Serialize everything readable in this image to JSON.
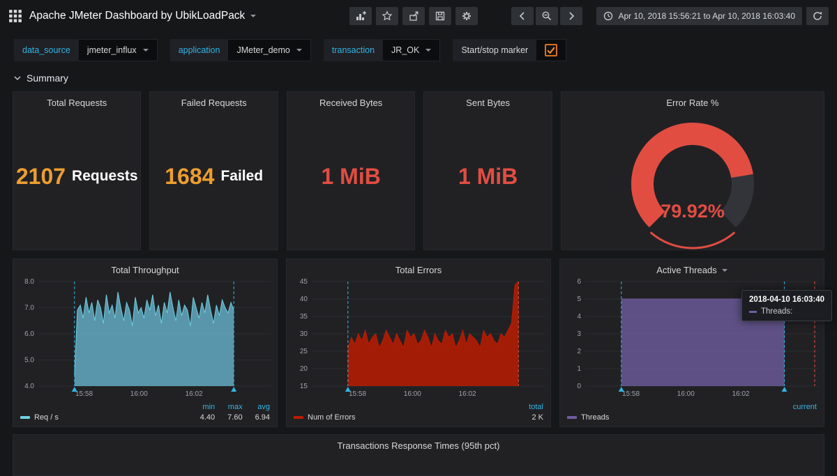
{
  "navbar": {
    "title": "Apache JMeter Dashboard by UbikLoadPack",
    "time_range": "Apr 10, 2018 15:56:21 to Apr 10, 2018 16:03:40"
  },
  "filters": [
    {
      "label": "data_source",
      "value": "jmeter_influx"
    },
    {
      "label": "application",
      "value": "JMeter_demo"
    },
    {
      "label": "transaction",
      "value": "JR_OK"
    }
  ],
  "marker_toggle": {
    "label": "Start/stop marker",
    "checked": true
  },
  "section": {
    "title": "Summary"
  },
  "stats": [
    {
      "title": "Total Requests",
      "value": "2107",
      "suffix": "Requests",
      "color": "#ed9e2f"
    },
    {
      "title": "Failed Requests",
      "value": "1684",
      "suffix": "Failed",
      "color": "#ed9e2f"
    },
    {
      "title": "Received Bytes",
      "value": "1 MiB",
      "suffix": "",
      "color": "#e24d42"
    },
    {
      "title": "Sent Bytes",
      "value": "1 MiB",
      "suffix": "",
      "color": "#e24d42"
    }
  ],
  "chart_gauge": {
    "type": "gauge",
    "title": "Error Rate %",
    "percent": 79.92,
    "label": "79.92%",
    "color": "#e24d42",
    "track_color": "#32343a",
    "range": [
      0,
      100
    ]
  },
  "chart_data": [
    {
      "id": "total-throughput",
      "type": "area",
      "title": "Total Throughput",
      "color": "#6ed0e0",
      "fill": "rgba(111,195,223,0.72)",
      "ymin": 4,
      "ymax": 8,
      "yticks": [
        "4.0",
        "5.0",
        "6.0",
        "7.0",
        "8.0"
      ],
      "xticks": [
        {
          "label": "15:58",
          "pos": 0.196
        },
        {
          "label": "16:00",
          "pos": 0.432
        },
        {
          "label": "16:02",
          "pos": 0.668
        }
      ],
      "data_start": 0.155,
      "data_end": 0.839,
      "values": [
        4.4,
        6.9,
        7.1,
        6.6,
        7.4,
        6.8,
        7.2,
        6.5,
        7.3,
        7.0,
        6.4,
        7.5,
        6.8,
        7.1,
        6.6,
        7.6,
        7.0,
        6.5,
        7.2,
        6.9,
        6.3,
        7.4,
        6.8,
        7.0,
        6.6,
        7.3,
        6.9,
        7.5,
        6.7,
        7.1,
        6.4,
        7.2,
        6.8,
        7.6,
        7.0,
        6.5,
        7.3,
        6.7,
        7.1,
        6.9,
        6.3,
        7.4,
        7.0,
        6.6,
        7.2,
        6.8,
        7.5,
        6.9,
        6.4,
        7.1,
        6.7,
        7.3,
        7.0,
        6.8,
        7.2,
        6.9
      ],
      "annotations": [
        {
          "pos": 0.155,
          "color": "#33b5e5",
          "marker": true
        },
        {
          "pos": 0.839,
          "color": "#33b5e5",
          "marker": true
        }
      ],
      "legend": {
        "series": "Req / s",
        "stats": [
          {
            "label": "min",
            "value": "4.40"
          },
          {
            "label": "max",
            "value": "7.60"
          },
          {
            "label": "avg",
            "value": "6.94"
          }
        ]
      }
    },
    {
      "id": "total-errors",
      "type": "area",
      "title": "Total Errors",
      "color": "#bf1b00",
      "fill": "rgba(191,27,0,0.82)",
      "ymin": 15,
      "ymax": 45,
      "yticks": [
        "15",
        "20",
        "25",
        "30",
        "35",
        "40",
        "45"
      ],
      "xticks": [
        {
          "label": "15:58",
          "pos": 0.196
        },
        {
          "label": "16:00",
          "pos": 0.432
        },
        {
          "label": "16:02",
          "pos": 0.668
        }
      ],
      "data_start": 0.155,
      "data_end": 0.887,
      "values": [
        26,
        29,
        27,
        30,
        28,
        31,
        27,
        29,
        30,
        26,
        28,
        31,
        29,
        27,
        30,
        28,
        26,
        31,
        29,
        30,
        27,
        28,
        31,
        29,
        26,
        30,
        28,
        27,
        31,
        29,
        30,
        26,
        28,
        31,
        27,
        30,
        29,
        28,
        26,
        31,
        29,
        30,
        28,
        27,
        30,
        29,
        31,
        33,
        44,
        45
      ],
      "annotations": [
        {
          "pos": 0.155,
          "color": "#33b5e5",
          "marker": true
        },
        {
          "pos": 0.887,
          "color": "#e24d42",
          "marker": false
        }
      ],
      "legend": {
        "series": "Num of Errors",
        "stats": [
          {
            "label": "total",
            "value": "2 K"
          }
        ]
      }
    },
    {
      "id": "active-threads",
      "type": "area",
      "title": "Active Threads",
      "title_caret": true,
      "color": "#705da0",
      "fill": "rgba(112,93,160,0.78)",
      "ymin": 0,
      "ymax": 6,
      "yticks": [
        "0",
        "1",
        "2",
        "3",
        "4",
        "5",
        "6"
      ],
      "xticks": [
        {
          "label": "15:58",
          "pos": 0.196
        },
        {
          "label": "16:00",
          "pos": 0.432
        },
        {
          "label": "16:02",
          "pos": 0.668
        }
      ],
      "data_start": 0.155,
      "data_end": 0.855,
      "values": [
        5,
        5,
        5,
        5,
        5,
        5
      ],
      "annotations": [
        {
          "pos": 0.155,
          "color": "#33b5e5",
          "marker": true
        },
        {
          "pos": 0.855,
          "color": "#33b5e5",
          "marker": true
        },
        {
          "pos": 0.985,
          "color": "#e24d42",
          "marker": false
        }
      ],
      "legend": {
        "series": "Threads",
        "stats": [
          {
            "label": "current",
            "value": ""
          }
        ]
      },
      "tooltip": {
        "time": "2018-04-10 16:03:40",
        "series_label": "Threads:",
        "swatch": "#705da0"
      }
    }
  ],
  "bottom_panel": {
    "title": "Transactions Response Times (95th pct)"
  },
  "colors": {
    "accent_blue": "#33b5e5",
    "orange": "#ed9e2f",
    "red": "#e24d42",
    "panel_bg": "#212124",
    "page_bg": "#161719"
  },
  "icons": {
    "apps-grid-icon": "3x3-grid",
    "caret-down-icon": "triangle-down",
    "add-panel-icon": "bar-chart-plus",
    "star-icon": "star-outline",
    "share-icon": "box-arrow",
    "save-icon": "floppy-disk",
    "settings-icon": "gear",
    "chevron-left-icon": "chevron-left",
    "zoom-out-icon": "magnifier-minus",
    "chevron-right-icon": "chevron-right",
    "clock-icon": "clock",
    "refresh-icon": "circular-arrow",
    "check-icon": "check-mark",
    "collapse-chevron-icon": "chevron-down"
  }
}
